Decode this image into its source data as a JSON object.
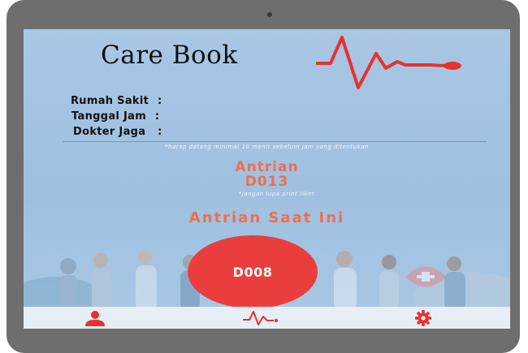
{
  "app": {
    "title": "Care Book"
  },
  "info": {
    "hospital_label": "Rumah Sakit",
    "datetime_label": "Tanggal Jam",
    "doctor_label": "Dokter Jaga",
    "separator": ":"
  },
  "note": "*harap datang minimal 10 menit sebelum jam yang ditentukan",
  "queue": {
    "label": "Antrian",
    "number": "D013",
    "reminder": "*Jangan lupa print tiket"
  },
  "current": {
    "label": "Antrian Saat Ini",
    "number": "D008"
  },
  "tabs": [
    {
      "icon": "user-icon"
    },
    {
      "icon": "heartbeat-icon"
    },
    {
      "icon": "gear-icon"
    }
  ],
  "colors": {
    "accent": "#e8312e",
    "queue_text": "#ee6f4e",
    "background": "#a9c6e4",
    "tabbar": "#e7eef6"
  }
}
